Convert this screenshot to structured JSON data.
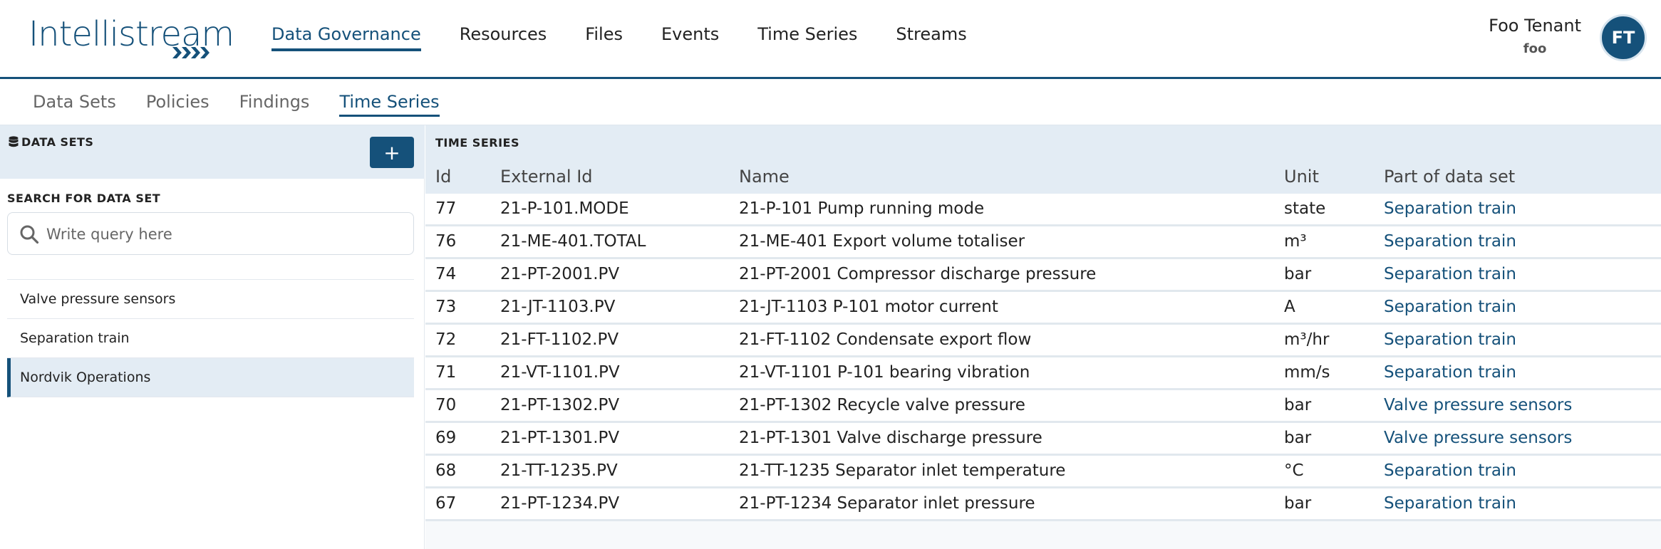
{
  "brand": {
    "name": "Intellistream",
    "primary_color": "#15517a"
  },
  "main_nav": {
    "items": [
      {
        "label": "Data Governance",
        "active": true
      },
      {
        "label": "Resources",
        "active": false
      },
      {
        "label": "Files",
        "active": false
      },
      {
        "label": "Events",
        "active": false
      },
      {
        "label": "Time Series",
        "active": false
      },
      {
        "label": "Streams",
        "active": false
      }
    ]
  },
  "user": {
    "name": "Foo Tenant",
    "tenant": "foo",
    "initials": "FT"
  },
  "sub_nav": {
    "items": [
      {
        "label": "Data Sets",
        "active": false
      },
      {
        "label": "Policies",
        "active": false
      },
      {
        "label": "Findings",
        "active": false
      },
      {
        "label": "Time Series",
        "active": true
      }
    ]
  },
  "data_sets_panel": {
    "title": "DATA SETS",
    "add_label": "+",
    "search_label": "SEARCH FOR DATA SET",
    "search_placeholder": "Write query here",
    "search_value": "",
    "items": [
      {
        "label": "Valve pressure sensors",
        "selected": false
      },
      {
        "label": "Separation train",
        "selected": false
      },
      {
        "label": "Nordvik Operations",
        "selected": true
      }
    ]
  },
  "time_series": {
    "title": "TIME SERIES",
    "columns": [
      "Id",
      "External Id",
      "Name",
      "Unit",
      "Part of data set"
    ],
    "rows": [
      {
        "id": "77",
        "external_id": "21-P-101.MODE",
        "name": "21-P-101 Pump running mode",
        "unit": "state",
        "data_set": "Separation train"
      },
      {
        "id": "76",
        "external_id": "21-ME-401.TOTAL",
        "name": "21-ME-401 Export volume totaliser",
        "unit": "m³",
        "data_set": "Separation train"
      },
      {
        "id": "74",
        "external_id": "21-PT-2001.PV",
        "name": "21-PT-2001 Compressor discharge pressure",
        "unit": "bar",
        "data_set": "Separation train"
      },
      {
        "id": "73",
        "external_id": "21-JT-1103.PV",
        "name": "21-JT-1103 P-101 motor current",
        "unit": "A",
        "data_set": "Separation train"
      },
      {
        "id": "72",
        "external_id": "21-FT-1102.PV",
        "name": "21-FT-1102 Condensate export flow",
        "unit": "m³/hr",
        "data_set": "Separation train"
      },
      {
        "id": "71",
        "external_id": "21-VT-1101.PV",
        "name": "21-VT-1101 P-101 bearing vibration",
        "unit": "mm/s",
        "data_set": "Separation train"
      },
      {
        "id": "70",
        "external_id": "21-PT-1302.PV",
        "name": "21-PT-1302 Recycle valve pressure",
        "unit": "bar",
        "data_set": "Valve pressure sensors"
      },
      {
        "id": "69",
        "external_id": "21-PT-1301.PV",
        "name": "21-PT-1301 Valve discharge pressure",
        "unit": "bar",
        "data_set": "Valve pressure sensors"
      },
      {
        "id": "68",
        "external_id": "21-TT-1235.PV",
        "name": "21-TT-1235 Separator inlet temperature",
        "unit": "°C",
        "data_set": "Separation train"
      },
      {
        "id": "67",
        "external_id": "21-PT-1234.PV",
        "name": "21-PT-1234 Separator inlet pressure",
        "unit": "bar",
        "data_set": "Separation train"
      }
    ]
  }
}
